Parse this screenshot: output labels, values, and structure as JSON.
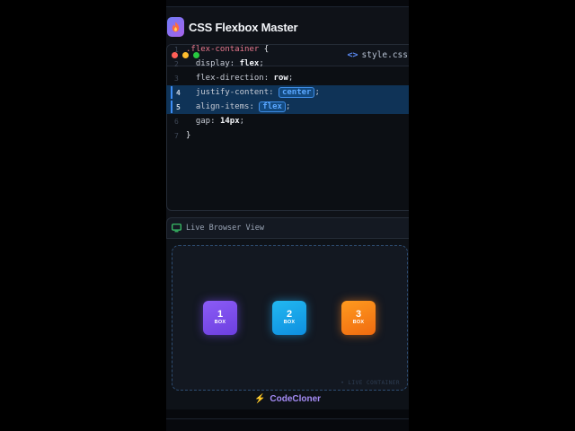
{
  "app": {
    "title": "CSS Flexbox Master",
    "logo_icon": "flame-icon"
  },
  "editor": {
    "file_name": "style.css",
    "file_icon": "code-icon",
    "window_dots": [
      "#ff5f57",
      "#febc2e",
      "#28c840"
    ],
    "lines": [
      {
        "n": "1",
        "selector": ".flex-container",
        "brace": " {"
      },
      {
        "n": "2",
        "prop": "display:",
        "value": "flex",
        "semi": ";"
      },
      {
        "n": "3",
        "prop": "flex-direction:",
        "value": "row",
        "semi": ";"
      },
      {
        "n": "4",
        "prop": "justify-content:",
        "value": "center",
        "semi": ";",
        "highlighted": true
      },
      {
        "n": "5",
        "prop": "align-items:",
        "value": "flex",
        "semi": ";",
        "highlighted": true
      },
      {
        "n": "6",
        "prop": "gap:",
        "value": "14px",
        "semi": ";"
      },
      {
        "n": "7",
        "brace": "}"
      }
    ]
  },
  "live_view": {
    "label": "Live Browser View",
    "icon": "monitor-icon",
    "container_tag": "• LIVE CONTAINER",
    "boxes": [
      {
        "num": "1",
        "label": "BOX",
        "color": "#7c4dff"
      },
      {
        "num": "2",
        "label": "BOX",
        "color": "#1aa6ee"
      },
      {
        "num": "3",
        "label": "BOX",
        "color": "#ff8a1a"
      }
    ]
  },
  "branding": {
    "icon": "bolt-icon",
    "name": "CodeCloner"
  },
  "colors": {
    "accent": "#3d8df5",
    "highlight_bg": "#0f3357",
    "brand_purple": "#a58cf5"
  }
}
